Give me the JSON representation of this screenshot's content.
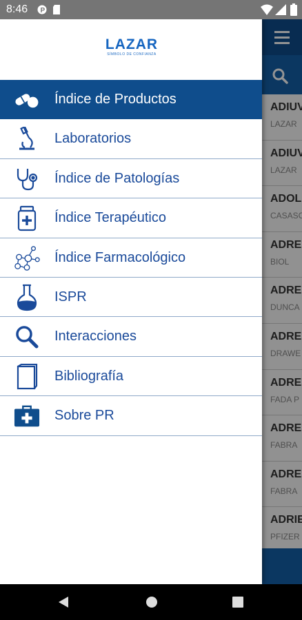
{
  "status_bar": {
    "time": "8:46"
  },
  "background_list": {
    "rows": [
      {
        "name": "ADIUV",
        "lab": "LAZAR"
      },
      {
        "name": "ADIUV",
        "lab": "LAZAR"
      },
      {
        "name": "ADOL",
        "lab": "CASASC"
      },
      {
        "name": "ADRE",
        "lab": "BIOL"
      },
      {
        "name": "ADRE",
        "lab": "DUNCA"
      },
      {
        "name": "ADRE",
        "lab": "DRAWE"
      },
      {
        "name": "ADRE",
        "lab": "FADA P"
      },
      {
        "name": "ADRE",
        "lab": "FABRA"
      },
      {
        "name": "ADRE",
        "lab": "FABRA"
      },
      {
        "name": "ADRIE",
        "lab": "PFIZER"
      }
    ]
  },
  "drawer": {
    "logo": {
      "name": "LAZAR",
      "tagline": "SÍMBOLO DE CONFIANZA"
    },
    "items": [
      {
        "label": "Índice de Productos",
        "icon": "pill-capsule-icon",
        "active": true
      },
      {
        "label": "Laboratorios",
        "icon": "microscope-icon"
      },
      {
        "label": "Índice de Patologías",
        "icon": "stethoscope-icon"
      },
      {
        "label": "Índice Terapéutico",
        "icon": "medicine-jar-icon"
      },
      {
        "label": "Índice Farmacológico",
        "icon": "molecule-icon"
      },
      {
        "label": "ISPR",
        "icon": "flask-icon"
      },
      {
        "label": "Interacciones",
        "icon": "magnifier-icon"
      },
      {
        "label": "Bibliografía",
        "icon": "book-icon"
      },
      {
        "label": "Sobre PR",
        "icon": "medical-kit-icon"
      }
    ]
  },
  "colors": {
    "primary": "#0f4d8c",
    "text": "#1a4a9a",
    "divider": "#8ea8c8"
  }
}
